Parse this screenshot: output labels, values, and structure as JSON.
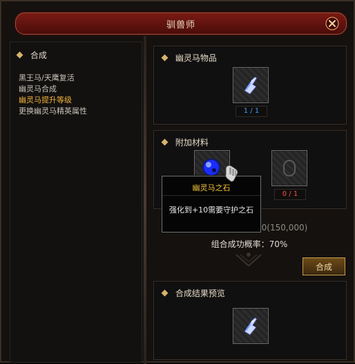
{
  "window": {
    "title": "驯兽师"
  },
  "left": {
    "header": "合成",
    "items": [
      {
        "label": "黑王马/天鹰复活",
        "active": false
      },
      {
        "label": "幽灵马合成",
        "active": false
      },
      {
        "label": "幽灵马提升等级",
        "active": true
      },
      {
        "label": "更换幽灵马精英属性",
        "active": false
      }
    ]
  },
  "panels": {
    "item": {
      "title": "幽灵马物品",
      "count": "1 / 1"
    },
    "materials": {
      "title": "附加材料",
      "count": "0 / 1"
    },
    "preview": {
      "title": "合成结果预览"
    }
  },
  "info": {
    "gold": "必要的金：150,000(150,000)",
    "rate": "组合成功概率：70%"
  },
  "buttons": {
    "combine": "合成"
  },
  "tooltip": {
    "title": "幽灵马之石",
    "desc": "强化到+10需要守护之石"
  },
  "icons": {
    "close": "close-icon",
    "item": "ghost-horse-item-icon",
    "material": "ghost-horse-stone-icon",
    "preview": "ghost-horse-preview-icon",
    "cursor": "gauntlet-cursor-icon"
  },
  "colors": {
    "active": "#f1b23a",
    "blue_count": "#3aa1ff",
    "red_count": "#ff4b3f"
  }
}
